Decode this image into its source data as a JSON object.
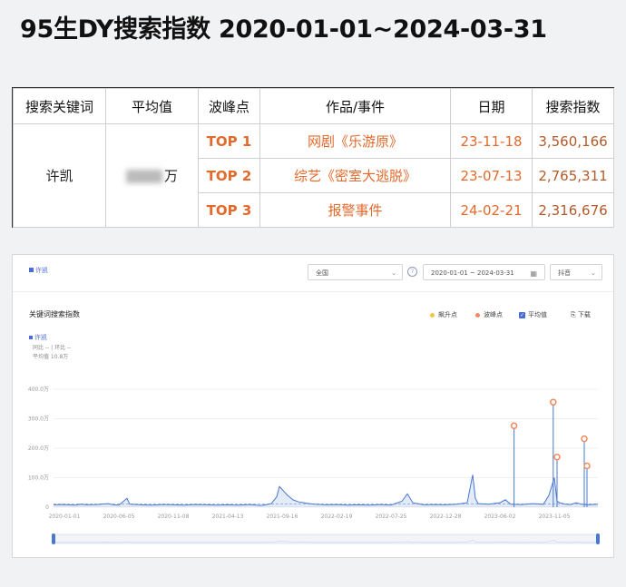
{
  "title": "95生DY搜索指数 2020-01-01~2024-03-31",
  "table": {
    "headers": [
      "搜索关键词",
      "平均值",
      "波峰点",
      "作品/事件",
      "日期",
      "搜索指数"
    ],
    "keyword": "许凯",
    "average_suffix": "万",
    "rows": [
      {
        "rank": "TOP 1",
        "event": "网剧《乐游原》",
        "date": "23-11-18",
        "index": "3,560,166"
      },
      {
        "rank": "TOP 2",
        "event": "综艺《密室大逃脱》",
        "date": "23-07-13",
        "index": "2,765,311"
      },
      {
        "rank": "TOP 3",
        "event": "报警事件",
        "date": "24-02-21",
        "index": "2,316,676"
      }
    ]
  },
  "panel": {
    "tab_label": "许凯",
    "region": "全国",
    "date_range": "2020-01-01 ~ 2024-03-31",
    "platform": "抖音",
    "chart_title": "关键词搜索指数",
    "legend": {
      "surge": "飙升点",
      "peak": "波峰点",
      "average": "平均值",
      "download": "下载"
    },
    "series_label": "许凯",
    "info_line1": "同比 -- | 环比 --",
    "info_line2": "平均值 10.8万"
  },
  "colors": {
    "line": "#4a78d0",
    "peak": "#f08a5d",
    "surge": "#f4c542",
    "accent": "#e26a2c"
  },
  "chart_data": {
    "type": "line",
    "ylim": [
      0,
      400
    ],
    "yunit": "万",
    "y_ticks": [
      "0",
      "100.0万",
      "200.0万",
      "300.0万",
      "400.0万"
    ],
    "x_ticks": [
      "2020-01-01",
      "2020-06-05",
      "2020-11-08",
      "2021-04-13",
      "2021-09-16",
      "2022-02-19",
      "2022-07-25",
      "2022-12-28",
      "2023-06-02",
      "2023-11-05"
    ],
    "average": 10.8,
    "series": [
      {
        "name": "许凯",
        "points": [
          [
            0,
            8
          ],
          [
            0.02,
            9
          ],
          [
            0.04,
            7
          ],
          [
            0.05,
            10
          ],
          [
            0.06,
            8
          ],
          [
            0.08,
            9
          ],
          [
            0.1,
            12
          ],
          [
            0.11,
            8
          ],
          [
            0.12,
            7
          ],
          [
            0.135,
            30
          ],
          [
            0.14,
            10
          ],
          [
            0.16,
            8
          ],
          [
            0.18,
            7
          ],
          [
            0.2,
            9
          ],
          [
            0.22,
            8
          ],
          [
            0.24,
            7
          ],
          [
            0.26,
            9
          ],
          [
            0.28,
            8
          ],
          [
            0.3,
            7
          ],
          [
            0.32,
            8
          ],
          [
            0.34,
            7
          ],
          [
            0.36,
            9
          ],
          [
            0.38,
            6
          ],
          [
            0.39,
            8
          ],
          [
            0.4,
            12
          ],
          [
            0.41,
            35
          ],
          [
            0.415,
            70
          ],
          [
            0.42,
            60
          ],
          [
            0.425,
            50
          ],
          [
            0.43,
            40
          ],
          [
            0.44,
            25
          ],
          [
            0.45,
            18
          ],
          [
            0.46,
            15
          ],
          [
            0.47,
            12
          ],
          [
            0.48,
            10
          ],
          [
            0.5,
            8
          ],
          [
            0.52,
            9
          ],
          [
            0.54,
            7
          ],
          [
            0.56,
            8
          ],
          [
            0.58,
            7
          ],
          [
            0.6,
            9
          ],
          [
            0.62,
            7
          ],
          [
            0.64,
            20
          ],
          [
            0.65,
            45
          ],
          [
            0.66,
            15
          ],
          [
            0.68,
            8
          ],
          [
            0.7,
            9
          ],
          [
            0.72,
            8
          ],
          [
            0.74,
            10
          ],
          [
            0.76,
            15
          ],
          [
            0.77,
            110
          ],
          [
            0.775,
            30
          ],
          [
            0.78,
            12
          ],
          [
            0.8,
            10
          ],
          [
            0.82,
            15
          ],
          [
            0.83,
            25
          ],
          [
            0.84,
            10
          ],
          [
            0.86,
            9
          ],
          [
            0.88,
            12
          ],
          [
            0.9,
            10
          ],
          [
            0.91,
            40
          ],
          [
            0.92,
            100
          ],
          [
            0.925,
            20
          ],
          [
            0.93,
            15
          ],
          [
            0.94,
            10
          ],
          [
            0.95,
            9
          ],
          [
            0.96,
            15
          ],
          [
            0.97,
            10
          ],
          [
            0.98,
            8
          ],
          [
            1.0,
            10
          ]
        ]
      }
    ],
    "peaks": [
      [
        0.846,
        276
      ],
      [
        0.918,
        356
      ],
      [
        0.925,
        170
      ],
      [
        0.975,
        232
      ],
      [
        0.98,
        140
      ]
    ]
  }
}
